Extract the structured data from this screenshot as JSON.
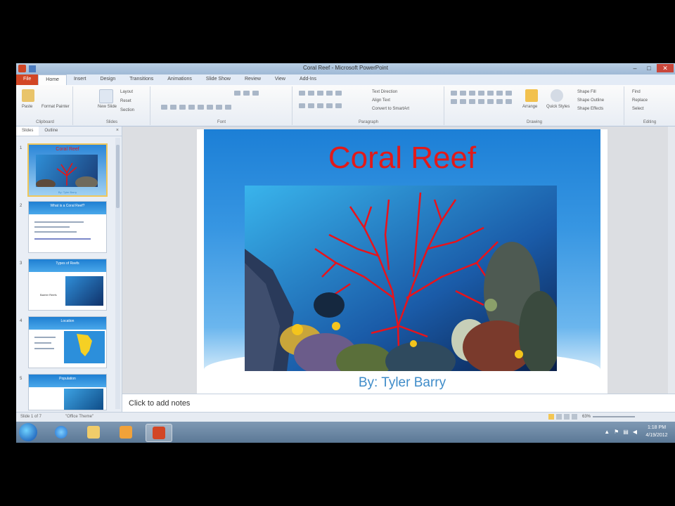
{
  "window": {
    "title": "Coral Reef - Microsoft PowerPoint",
    "controls": [
      "–",
      "□",
      "✕"
    ]
  },
  "tabs": [
    "File",
    "Home",
    "Insert",
    "Design",
    "Transitions",
    "Animations",
    "Slide Show",
    "Review",
    "View",
    "Add-Ins"
  ],
  "ribbon": {
    "clipboard": {
      "paste": "Paste",
      "format_painter": "Format Painter",
      "label": "Clipboard"
    },
    "slides": {
      "new_slide": "New Slide",
      "layout": "Layout",
      "reset": "Reset",
      "section": "Section",
      "label": "Slides"
    },
    "font": {
      "label": "Font"
    },
    "paragraph": {
      "text_direction": "Text Direction",
      "align_text": "Align Text",
      "convert": "Convert to SmartArt",
      "label": "Paragraph"
    },
    "drawing": {
      "arrange": "Arrange",
      "quick_styles": "Quick Styles",
      "shape_fill": "Shape Fill",
      "shape_outline": "Shape Outline",
      "shape_effects": "Shape Effects",
      "label": "Drawing"
    },
    "editing": {
      "find": "Find",
      "replace": "Replace",
      "select": "Select",
      "label": "Editing"
    }
  },
  "panel": {
    "tabs": [
      "Slides",
      "Outline"
    ],
    "close": "×",
    "thumbnails": [
      {
        "num": "1",
        "title": "Coral Reef",
        "subtitle": "By: Tyler Barry"
      },
      {
        "num": "2",
        "title": "What is a Coral Reef?"
      },
      {
        "num": "3",
        "title": "Types of Reefs",
        "label": "Barrier Reefs"
      },
      {
        "num": "4",
        "title": "Location"
      },
      {
        "num": "5",
        "title": "Population"
      }
    ]
  },
  "slide": {
    "title": "Coral Reef",
    "subtitle": "By: Tyler Barry"
  },
  "notes": {
    "placeholder": "Click to add notes"
  },
  "status": {
    "slide": "Slide 1 of 7",
    "theme": "\"Office Theme\"",
    "zoom": "63%"
  },
  "taskbar": {
    "apps": [
      "internet-explorer",
      "file-explorer",
      "media-player",
      "powerpoint"
    ],
    "time": "1:18 PM",
    "date": "4/19/2012"
  },
  "colors": {
    "title_red": "#e21a1a",
    "subtitle_blue": "#3f8cc9",
    "file_tab": "#d24625"
  }
}
